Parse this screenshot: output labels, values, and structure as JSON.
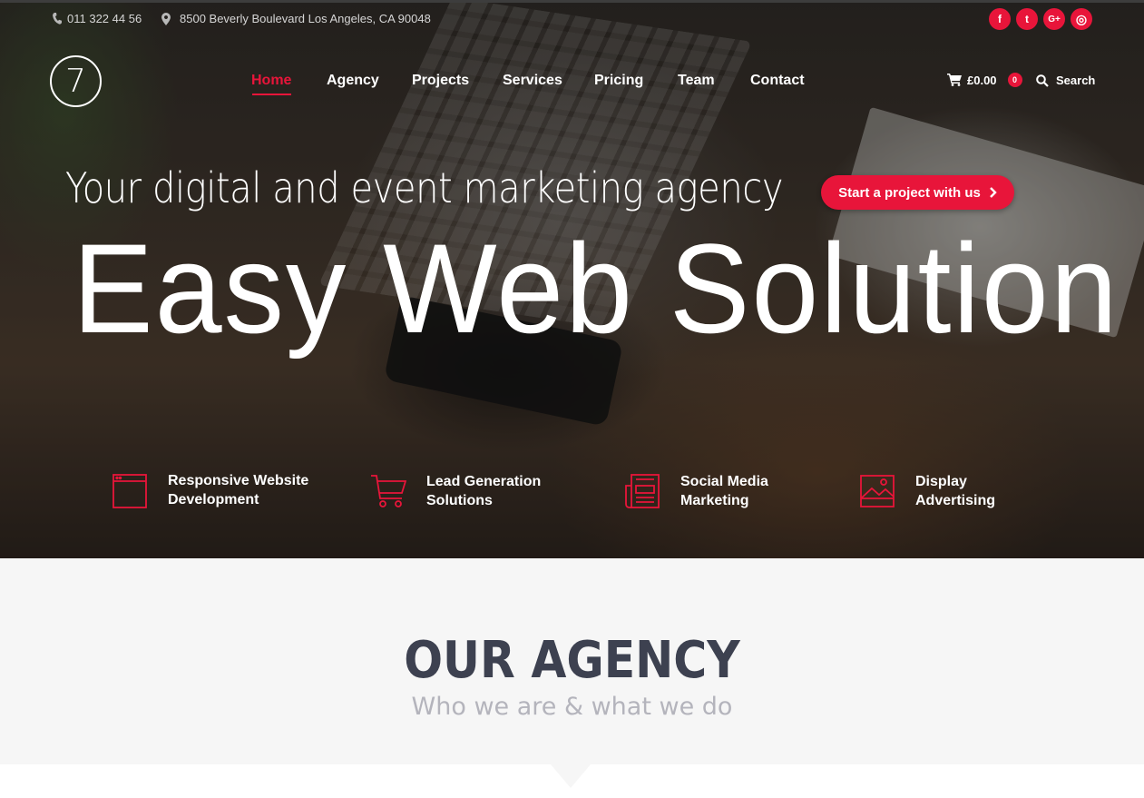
{
  "topbar": {
    "phone": "011 322 44 56",
    "address": "8500 Beverly Boulevard Los Angeles, CA 90048",
    "social": [
      {
        "icon": "facebook-icon",
        "glyph": "f"
      },
      {
        "icon": "twitter-icon",
        "glyph": "t"
      },
      {
        "icon": "google-plus-icon",
        "glyph": "G+"
      },
      {
        "icon": "dribbble-icon",
        "glyph": "◎"
      }
    ]
  },
  "logo": {
    "text": "7"
  },
  "nav": {
    "items": [
      "Home",
      "Agency",
      "Projects",
      "Services",
      "Pricing",
      "Team",
      "Contact"
    ],
    "active": "Home",
    "cart_total": "£0.00",
    "cart_count": "0",
    "search_label": "Search"
  },
  "hero": {
    "tagline": "Your digital and event marketing agency",
    "cta_label": "Start a project with us",
    "headline": "Easy Web Solution",
    "features": [
      {
        "label": "Responsive Website\nDevelopment",
        "icon": "browser-window-icon"
      },
      {
        "label": "Lead Generation\nSolutions",
        "icon": "shopping-cart-icon"
      },
      {
        "label": "Social Media\nMarketing",
        "icon": "newspaper-icon"
      },
      {
        "label": "Display\nAdvertising",
        "icon": "image-icon"
      }
    ]
  },
  "agency": {
    "title": "OUR AGENCY",
    "subtitle": "Who we are & what we do"
  },
  "colors": {
    "accent": "#e8153a",
    "heading": "#3d4150",
    "subheading": "#b4b4bc",
    "section_bg": "#f6f6f6"
  }
}
